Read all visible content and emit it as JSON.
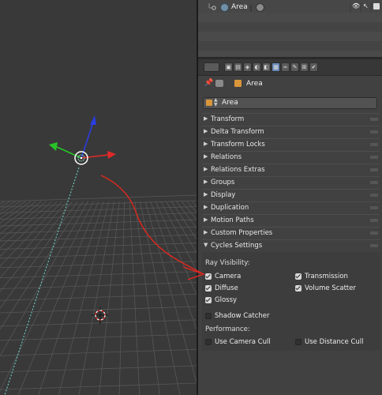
{
  "outliner": {
    "object_name": "Area"
  },
  "properties": {
    "context_path": "Area",
    "datablock_name": "Area",
    "panels": [
      {
        "label": "Transform",
        "expanded": false
      },
      {
        "label": "Delta Transform",
        "expanded": false
      },
      {
        "label": "Transform Locks",
        "expanded": false
      },
      {
        "label": "Relations",
        "expanded": false
      },
      {
        "label": "Relations Extras",
        "expanded": false
      },
      {
        "label": "Groups",
        "expanded": false
      },
      {
        "label": "Display",
        "expanded": false
      },
      {
        "label": "Duplication",
        "expanded": false
      },
      {
        "label": "Motion Paths",
        "expanded": false
      },
      {
        "label": "Custom Properties",
        "expanded": false
      },
      {
        "label": "Cycles Settings",
        "expanded": true
      }
    ],
    "cycles": {
      "ray_visibility_label": "Ray Visibility:",
      "camera": "Camera",
      "transmission": "Transmission",
      "diffuse": "Diffuse",
      "volume_scatter": "Volume Scatter",
      "glossy": "Glossy",
      "shadow_catcher": "Shadow Catcher",
      "performance_label": "Performance:",
      "use_camera_cull": "Use Camera Cull",
      "use_distance_cull": "Use Distance Cull"
    }
  },
  "colors": {
    "accent_blue": "#5680c2",
    "annotation_red": "#e0281e",
    "axis_x": "#e02a2a",
    "axis_y": "#28c428",
    "axis_z": "#2a3ee0"
  }
}
